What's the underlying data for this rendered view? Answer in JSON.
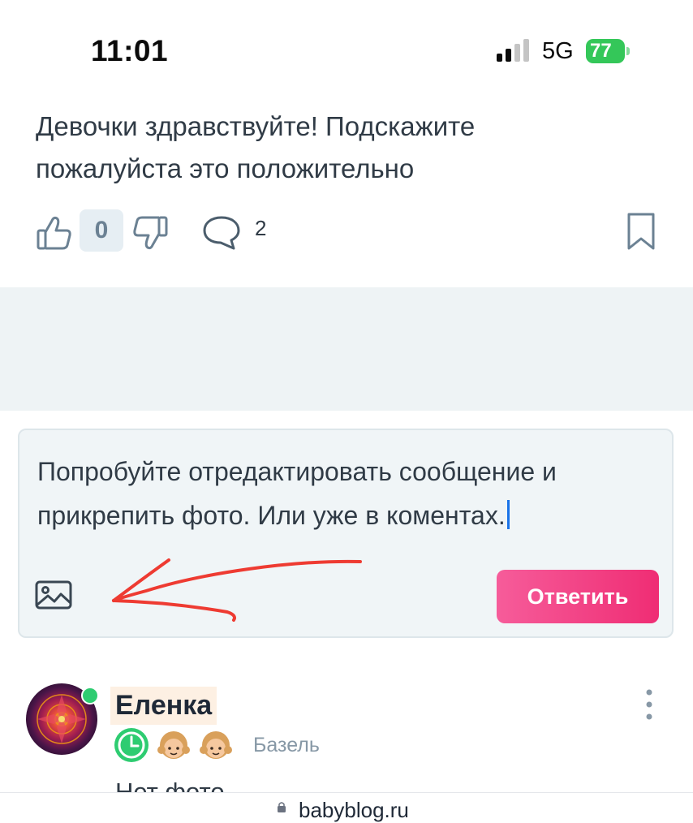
{
  "status_bar": {
    "time": "11:01",
    "network": "5G",
    "battery": "77"
  },
  "post": {
    "text": "Девочки здравствуйте! Подскажите пожалуйста это положительно",
    "likes": "0",
    "comments": "2",
    "icons": [
      "thumbs-up-icon",
      "thumbs-down-icon",
      "comment-icon",
      "bookmark-icon"
    ]
  },
  "reply": {
    "text": "Попробуйте отредактировать сообщение и прикрепить фото. Или уже в коментах.",
    "submit_label": "Ответить",
    "icon": "image-icon",
    "accent": "#ef2d74"
  },
  "comment": {
    "author": "Еленка",
    "city": "Базель",
    "text": "Нет фото",
    "badges": [
      "clock-icon",
      "girl-emoji",
      "girl-emoji"
    ],
    "online_color": "#2ecc71"
  },
  "browser": {
    "url": "babyblog.ru"
  }
}
